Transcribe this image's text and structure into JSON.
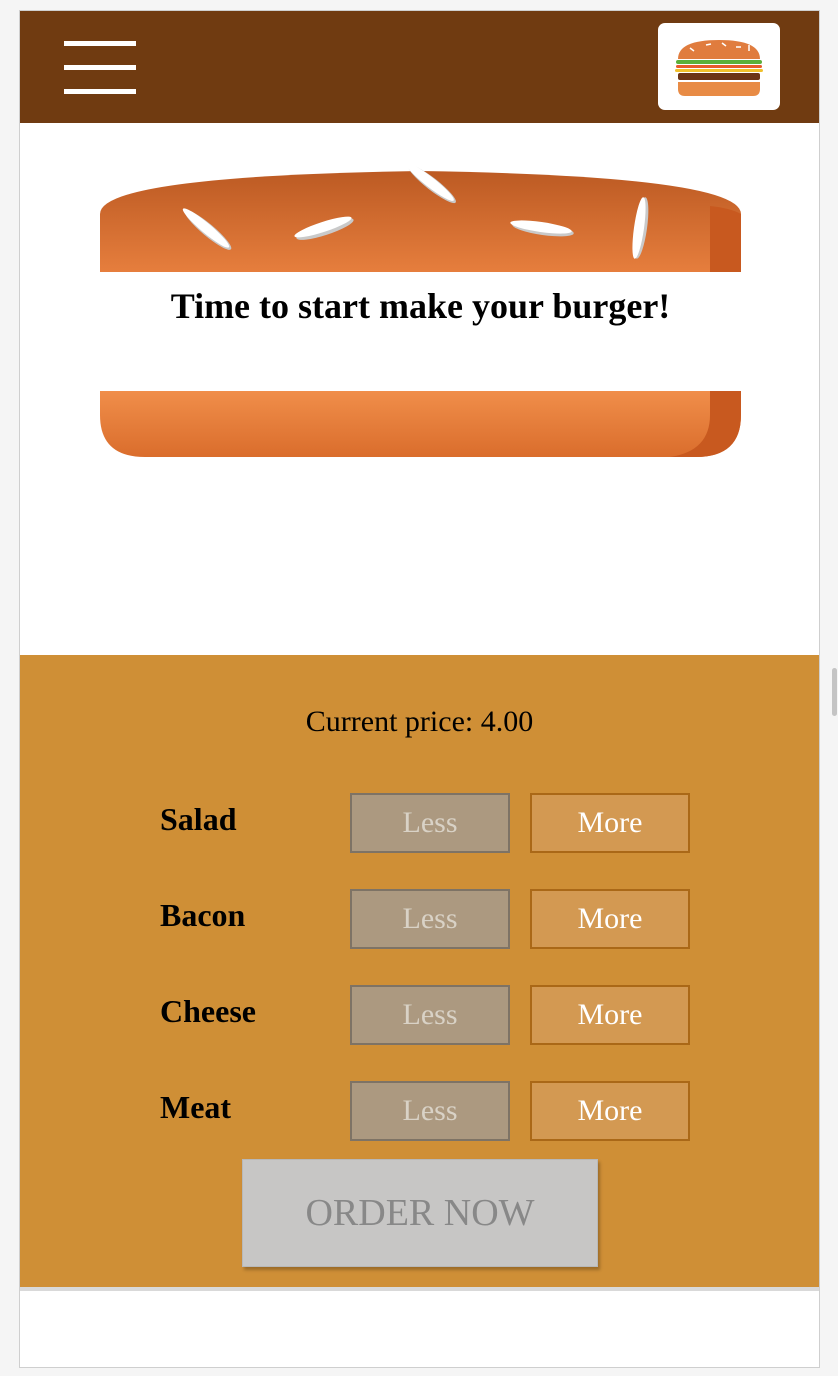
{
  "toolbar": {
    "menu_icon": "hamburger-menu-icon",
    "logo_icon": "burger-logo-icon",
    "background": "#703B11"
  },
  "burger": {
    "message": "Time to start make your burger!"
  },
  "build_controls": {
    "price_label": "Current price: 4.00",
    "background": "#CF8F36",
    "controls": [
      {
        "label": "Salad",
        "less": "Less",
        "more": "More"
      },
      {
        "label": "Bacon",
        "less": "Less",
        "more": "More"
      },
      {
        "label": "Cheese",
        "less": "Less",
        "more": "More"
      },
      {
        "label": "Meat",
        "less": "Less",
        "more": "More"
      }
    ],
    "order_button": "ORDER NOW"
  }
}
